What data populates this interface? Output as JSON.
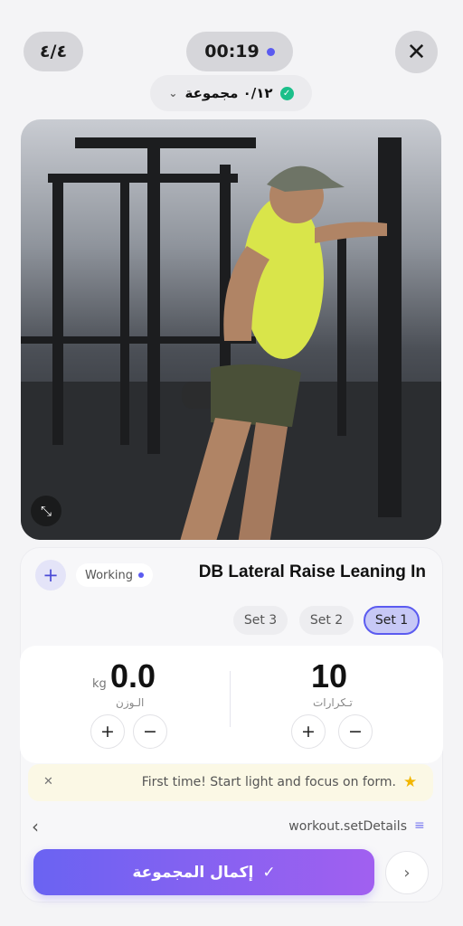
{
  "header": {
    "counter": "٤/٤",
    "timer": "00:19",
    "close_glyph": "✕",
    "sets_progress": "٠/١٢ مجموعة",
    "chevron": "⌄",
    "check_glyph": "✓"
  },
  "media": {
    "expand_glyph": "⤡"
  },
  "exercise": {
    "add_glyph": "+",
    "badge": "Working",
    "title": "DB Lateral Raise Leaning In",
    "sets": [
      {
        "label": "Set 3"
      },
      {
        "label": "Set 2"
      },
      {
        "label": "Set 1",
        "selected": true
      }
    ]
  },
  "inputs": {
    "weight": {
      "value": "0.0",
      "unit": "kg",
      "label": "الـوزن"
    },
    "reps": {
      "value": "10",
      "label": "تـكرارات"
    },
    "plus": "+",
    "minus": "−"
  },
  "tip": {
    "close_glyph": "✕",
    "text": "First time! Start light and focus on form.",
    "star": "★"
  },
  "footer": {
    "back": "‹",
    "details_link": "workout.setDetails",
    "details_icon": "≡",
    "complete_label": "إكمال المجموعة",
    "complete_check": "✓",
    "next": "›"
  },
  "colors": {
    "accent": "#5b5bf0",
    "success": "#1bbf8a",
    "tip_bg": "#fbf8e5"
  }
}
